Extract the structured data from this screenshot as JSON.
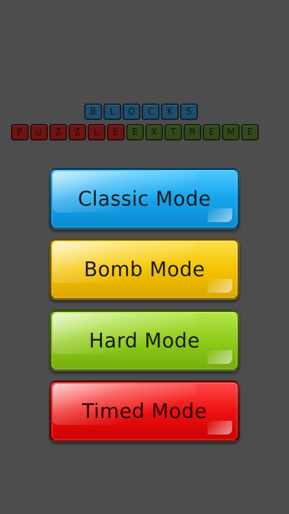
{
  "logo": {
    "row1": [
      "B",
      "L",
      "O",
      "C",
      "K",
      "S"
    ],
    "row2_red": [
      "P",
      "U",
      "Z",
      "Z",
      "L",
      "E"
    ],
    "row2_green": [
      "E",
      "X",
      "T",
      "R",
      "E",
      "M",
      "E"
    ]
  },
  "menu": {
    "classic_label": "Classic Mode",
    "bomb_label": "Bomb Mode",
    "hard_label": "Hard Mode",
    "timed_label": "Timed Mode"
  },
  "colors": {
    "background": "#4d4d4d",
    "classic": "#15a4ec",
    "bomb": "#f4c300",
    "hard": "#8fcb1a",
    "timed": "#ee1111"
  }
}
